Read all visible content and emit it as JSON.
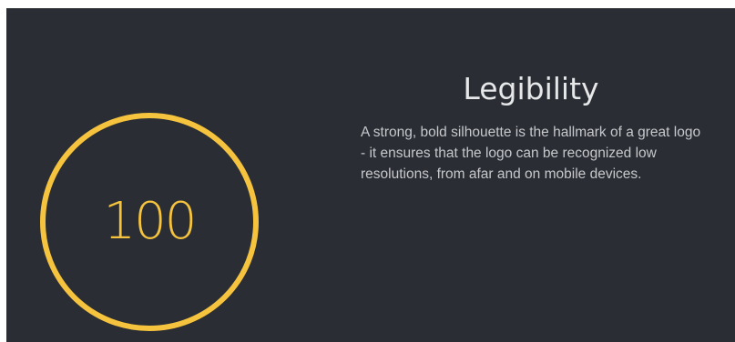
{
  "score": {
    "value": "100",
    "ring_color": "#f5c33d"
  },
  "feature": {
    "title": "Legibility",
    "description": "A strong, bold silhouette is the hallmark of a great logo - it ensures that the logo can be recognized low resolutions, from afar and on mobile devices."
  },
  "colors": {
    "background": "#2a2d33",
    "accent": "#f5c33d",
    "title_text": "#e6e7e9",
    "body_text": "#c6c8cc"
  }
}
